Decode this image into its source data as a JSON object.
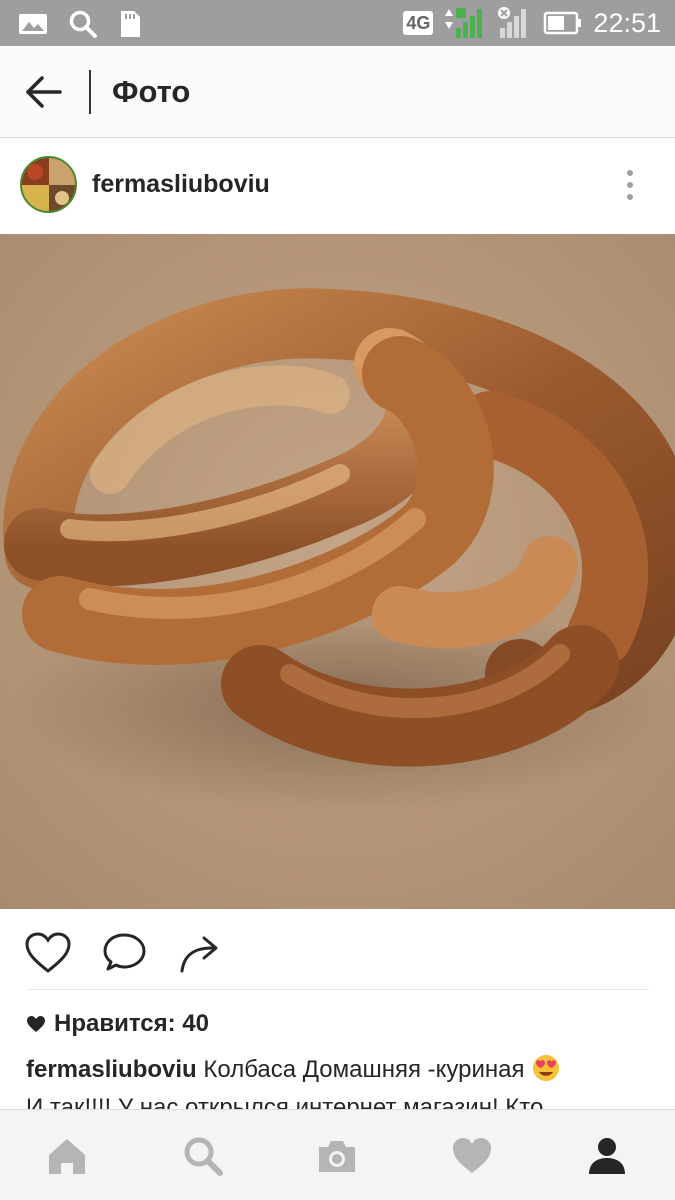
{
  "status_bar": {
    "network": "4G",
    "time": "22:51",
    "icons": [
      "image-icon",
      "search-icon",
      "sd-card-icon",
      "signal-icon",
      "no-signal-icon",
      "battery-icon"
    ]
  },
  "app_bar": {
    "title": "Фото",
    "back_icon": "arrow-left-icon"
  },
  "post": {
    "username": "fermasliuboviu",
    "photo_description": "sausage-photo",
    "likes_label": "Нравится: 40",
    "caption_text": "Колбаса Домашняя -куриная",
    "caption_emoji": "heart-eyes-emoji",
    "caption_second_line": "И так!!!! У нас открылся интернет магазин! Кто"
  },
  "action_icons": [
    "heart-icon",
    "comment-icon",
    "share-icon"
  ],
  "bottom_nav": {
    "items": [
      "home-icon",
      "search-icon",
      "camera-icon",
      "heart-icon",
      "profile-icon"
    ],
    "active": "profile-icon"
  },
  "colors": {
    "status_bar": "#9e9e9e",
    "app_bar": "#fafafa",
    "text": "#262626",
    "icon_inactive": "#b5b5b5",
    "icon_active": "#262626",
    "photo_background": "#b89a7d"
  }
}
